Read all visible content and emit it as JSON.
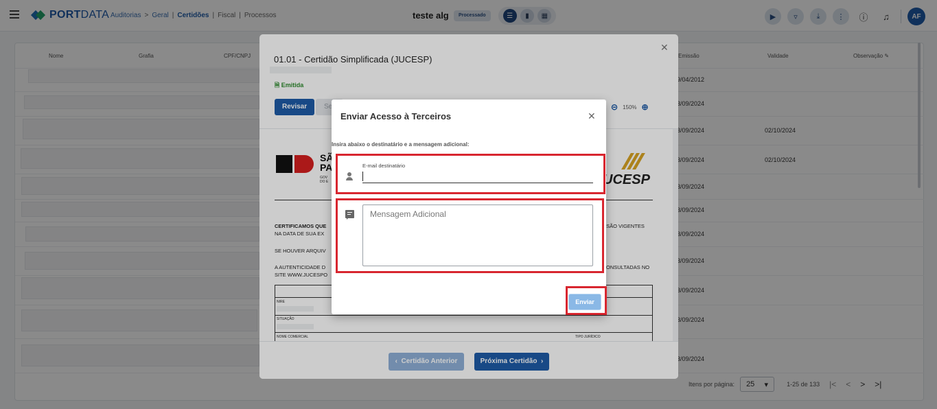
{
  "topbar": {
    "brand_bold": "PORT",
    "brand_light": "DATA",
    "breadcrumbs": [
      "Auditorias",
      ">",
      "Geral",
      "|",
      "Certidões",
      "|",
      "Fiscal",
      "|",
      "Processos"
    ],
    "project_title": "teste alg",
    "status_chip": "Processado",
    "view_icons": [
      "list-view-icon",
      "document-view-icon",
      "grid-view-icon"
    ],
    "tool_icons": [
      "play-icon",
      "filter-icon",
      "download-icon",
      "more-vert-icon",
      "help-icon",
      "bell-icon"
    ],
    "avatar_initials": "AF"
  },
  "table": {
    "headers_left": [
      "Nome",
      "Grafia",
      "CPF/CNPJ"
    ],
    "headers_right": [
      "Emissão",
      "Validade",
      "Observação"
    ],
    "rows": [
      {
        "emissao": "9/04/2012",
        "validade": ""
      },
      {
        "emissao": "3/09/2024",
        "validade": ""
      },
      {
        "emissao": "3/09/2024",
        "validade": "02/10/2024"
      },
      {
        "emissao": "3/09/2024",
        "validade": "02/10/2024"
      },
      {
        "emissao": "3/09/2024",
        "validade": ""
      },
      {
        "emissao": "3/09/2024",
        "validade": ""
      },
      {
        "emissao": "3/09/2024",
        "validade": ""
      },
      {
        "emissao": "3/09/2024",
        "validade": ""
      },
      {
        "emissao": "3/09/2024",
        "validade": ""
      },
      {
        "emissao": "3/09/2024",
        "validade": ""
      },
      {
        "emissao": "3/09/2024",
        "validade": ""
      }
    ],
    "pager": {
      "items_label": "Itens por página:",
      "page_size": "25",
      "range": "1-25 de 133"
    }
  },
  "cert_dialog": {
    "title": "01.01 - Certidão Simplificada (JUCESP)",
    "status": "Emitida",
    "revisar_label": "Revisar",
    "ghost_label": "Se",
    "zoom_level": "150%",
    "doc": {
      "sp_text_1": "SÃ",
      "sp_text_2": "PA",
      "sp_small_1": "GOV",
      "sp_small_2": "DO E",
      "jucesp": "UCESP",
      "para1_left": "CERTIFICAMOS QUE",
      "para1_left2": "NA DATA DE SUA EX",
      "para1_right": "E SÃO VIGENTES",
      "para2_left": "SE HOUVER ARQUIV",
      "para3_left": "A AUTENTICIDADE D",
      "para3_left2": "SITE WWW.JUCESPO",
      "para3_right": "ONSULTADAS NO",
      "nire_label": "NIRE",
      "situacao_label": "SITUAÇÃO",
      "nome_comercial_label": "NOME COMERCIAL",
      "tipo_juridico_label": "TIPO JURÍDICO"
    },
    "prev_label": "Certidão Anterior",
    "next_label": "Próxima Certidão"
  },
  "send_dialog": {
    "title": "Enviar Acesso à Terceiros",
    "instruction": "Insira abaixo o destinatário e a mensagem adicional:",
    "email_label": "E-mail destinatário",
    "email_value": "",
    "message_placeholder": "Mensagem Adicional",
    "submit_label": "Enviar"
  }
}
